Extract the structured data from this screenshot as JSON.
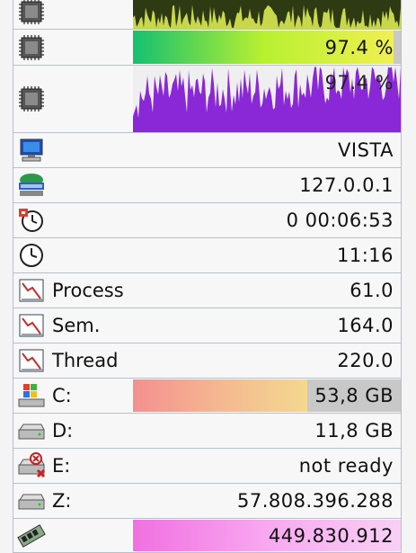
{
  "rows": [
    {
      "id": "cpu1-graph",
      "icon": "cpu-chip-icon",
      "label": "",
      "value": "",
      "kind": "graph",
      "color": "#c8d84a",
      "bg": "#2e3a12"
    },
    {
      "id": "cpu-usage",
      "icon": "cpu-chip-icon",
      "label": "",
      "value": "97.4 %",
      "kind": "bar",
      "percent": 97.4,
      "gradient": [
        "#14c070",
        "#b8f030",
        "#f0f050"
      ]
    },
    {
      "id": "cpu2-graph",
      "icon": "cpu-chip-icon",
      "label": "",
      "value": "97.4 %",
      "kind": "graph",
      "color": "#8a28d8",
      "bg": "#efefef"
    },
    {
      "id": "computer-name",
      "icon": "computer-icon",
      "label": "",
      "value": "VISTA",
      "kind": "text"
    },
    {
      "id": "ip-address",
      "icon": "network-icon",
      "label": "",
      "value": "127.0.0.1",
      "kind": "text"
    },
    {
      "id": "uptime",
      "icon": "uptime-clock-icon",
      "label": "",
      "value": "0   00:06:53",
      "kind": "text"
    },
    {
      "id": "clock",
      "icon": "clock-icon",
      "label": "",
      "value": "11:16",
      "kind": "text"
    },
    {
      "id": "process-count",
      "icon": "chart-line-icon",
      "label": "Process",
      "value": "61.0",
      "kind": "text"
    },
    {
      "id": "semaphore-count",
      "icon": "chart-line-icon",
      "label": "Sem.",
      "value": "164.0",
      "kind": "text"
    },
    {
      "id": "thread-count",
      "icon": "chart-line-icon",
      "label": "Thread",
      "value": "220.0",
      "kind": "text"
    },
    {
      "id": "drive-c",
      "icon": "windows-drive-icon",
      "label": "C:",
      "value": "53,8 GB",
      "kind": "bar",
      "percent": 65,
      "gradient": [
        "#f49090",
        "#f4b890",
        "#f4d890"
      ]
    },
    {
      "id": "drive-d",
      "icon": "hard-drive-icon",
      "label": "D:",
      "value": "11,8 GB",
      "kind": "text"
    },
    {
      "id": "drive-e",
      "icon": "drive-error-icon",
      "label": "E:",
      "value": "not ready",
      "kind": "text"
    },
    {
      "id": "drive-z",
      "icon": "hard-drive-icon",
      "label": "Z:",
      "value": "57.808.396.288",
      "kind": "text"
    },
    {
      "id": "memory",
      "icon": "memory-module-icon",
      "label": "",
      "value": "449.830.912",
      "kind": "bar",
      "percent": 100,
      "gradient": [
        "#f070e0",
        "#f8a8f0",
        "#f8d0f4"
      ]
    }
  ]
}
